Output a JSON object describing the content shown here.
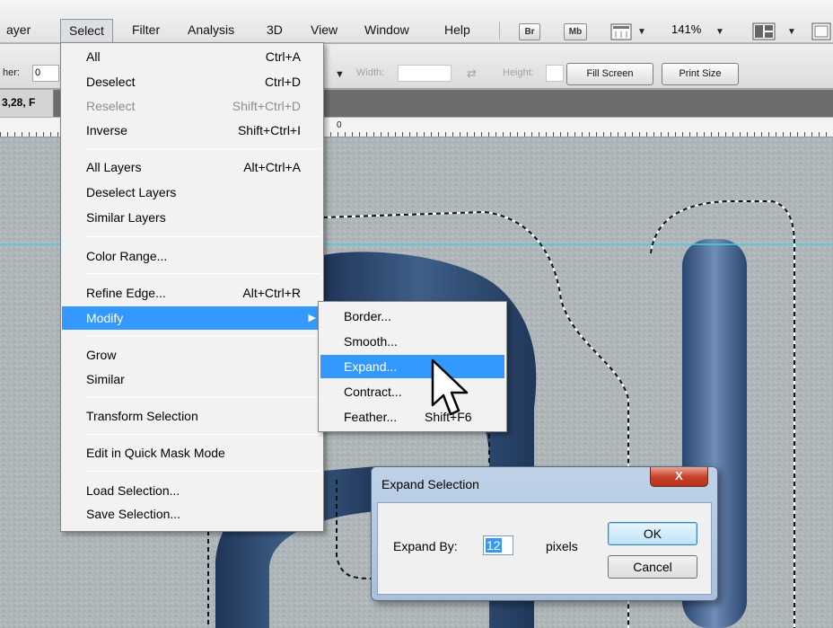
{
  "menubar": {
    "items": [
      "ayer",
      "Select",
      "Filter",
      "Analysis",
      "3D",
      "View",
      "Window",
      "Help"
    ],
    "app_buttons": [
      "Br",
      "Mb"
    ],
    "zoom": "141%"
  },
  "options_bar": {
    "feather_label": "her:",
    "feather_value": "0",
    "width_label": "Width:",
    "height_label": "Height:",
    "fill_screen": "Fill Screen",
    "print_size": "Print Size"
  },
  "document": {
    "tab_label": "3,28, F",
    "ruler_zero": "0"
  },
  "select_menu": {
    "items": [
      {
        "label": "All",
        "shortcut": "Ctrl+A"
      },
      {
        "label": "Deselect",
        "shortcut": "Ctrl+D"
      },
      {
        "label": "Reselect",
        "shortcut": "Shift+Ctrl+D"
      },
      {
        "label": "Inverse",
        "shortcut": "Shift+Ctrl+I"
      },
      {
        "label": "All Layers",
        "shortcut": "Alt+Ctrl+A"
      },
      {
        "label": "Deselect Layers",
        "shortcut": ""
      },
      {
        "label": "Similar Layers",
        "shortcut": ""
      },
      {
        "label": "Color Range...",
        "shortcut": ""
      },
      {
        "label": "Refine Edge...",
        "shortcut": "Alt+Ctrl+R"
      },
      {
        "label": "Modify",
        "shortcut": ""
      },
      {
        "label": "Grow",
        "shortcut": ""
      },
      {
        "label": "Similar",
        "shortcut": ""
      },
      {
        "label": "Transform Selection",
        "shortcut": ""
      },
      {
        "label": "Edit in Quick Mask Mode",
        "shortcut": ""
      },
      {
        "label": "Load Selection...",
        "shortcut": ""
      },
      {
        "label": "Save Selection...",
        "shortcut": ""
      }
    ]
  },
  "modify_menu": {
    "items": [
      {
        "label": "Border...",
        "shortcut": ""
      },
      {
        "label": "Smooth...",
        "shortcut": ""
      },
      {
        "label": "Expand...",
        "shortcut": ""
      },
      {
        "label": "Contract...",
        "shortcut": ""
      },
      {
        "label": "Feather...",
        "shortcut": "Shift+F6"
      }
    ]
  },
  "dialog": {
    "title": "Expand Selection",
    "close": "X",
    "label": "Expand By:",
    "value": "12",
    "units": "pixels",
    "ok": "OK",
    "cancel": "Cancel"
  },
  "colors": {
    "highlight": "#3399ff",
    "guide": "#40d0e0",
    "shape": "#2e4a70"
  }
}
